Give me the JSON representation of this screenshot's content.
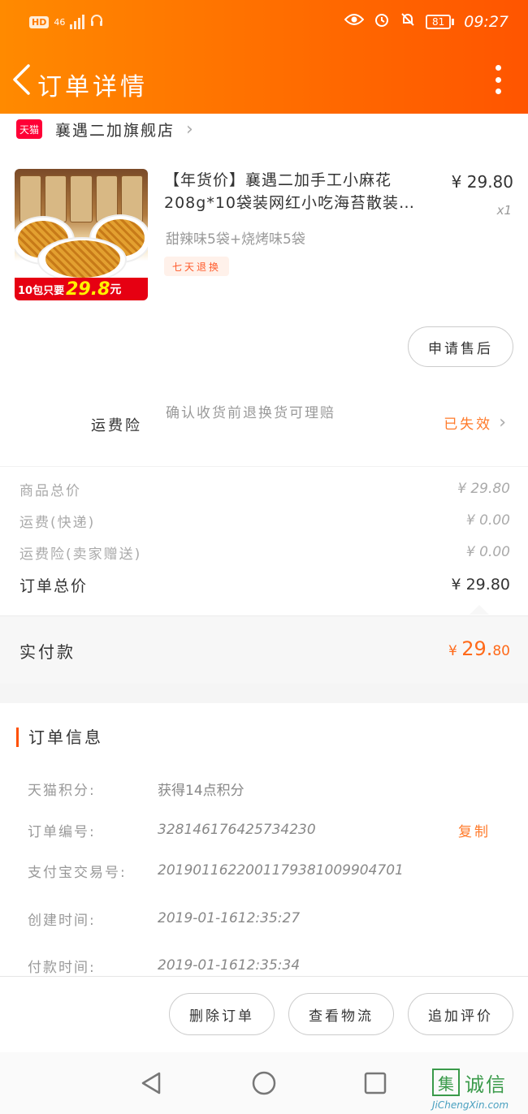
{
  "status_bar": {
    "hd": "HD",
    "network": "46",
    "battery": "81",
    "time": "09:27"
  },
  "nav": {
    "title": "订单详情"
  },
  "store": {
    "badge": "天猫",
    "name": "襄遇二加旗舰店"
  },
  "product": {
    "promo_prefix": "10包只要",
    "promo_price": "29.8",
    "promo_unit": "元",
    "title": "【年货价】襄遇二加手工小麻花208g*10袋装网红小吃海苔散装…",
    "price": "¥ 29.80",
    "qty": "x1",
    "spec": "甜辣味5袋+烧烤味5袋",
    "tag": "七天退换",
    "after_sale_label": "申请售后"
  },
  "insurance": {
    "label": "运费险",
    "desc": "确认收货前退换货可理赔",
    "status": "已失效"
  },
  "summary": {
    "rows": [
      {
        "label": "商品总价",
        "value": "¥ 29.80"
      },
      {
        "label": "运费(快递)",
        "value": "¥ 0.00"
      },
      {
        "label": "运费险(卖家赠送)",
        "value": "¥ 0.00"
      }
    ],
    "total_label": "订单总价",
    "total_value": "¥ 29.80",
    "paid_label": "实付款",
    "paid_symbol": "¥ ",
    "paid_int": "29.",
    "paid_dec": "80"
  },
  "order_info": {
    "heading": "订单信息",
    "rows": [
      {
        "label": "天猫积分:",
        "value": "获得14点积分"
      },
      {
        "label": "订单编号:",
        "value": "328146176425734230"
      },
      {
        "label": "支付宝交易号:",
        "value": "2019011622001179381009904701"
      },
      {
        "label": "创建时间:",
        "value": "2019-01-1612:35:27"
      },
      {
        "label": "付款时间:",
        "value": "2019-01-1612:35:34"
      }
    ],
    "copy_label": "复制"
  },
  "actions": {
    "delete": "删除订单",
    "logistics": "查看物流",
    "review": "追加评价"
  },
  "watermark": {
    "char": "集",
    "name": "诚信",
    "url": "JiChengXin.com"
  },
  "colors": {
    "header_start": "#ff8a00",
    "header_end": "#ff5500",
    "accent": "#ff6a1a",
    "tmall": "#ff0036"
  }
}
